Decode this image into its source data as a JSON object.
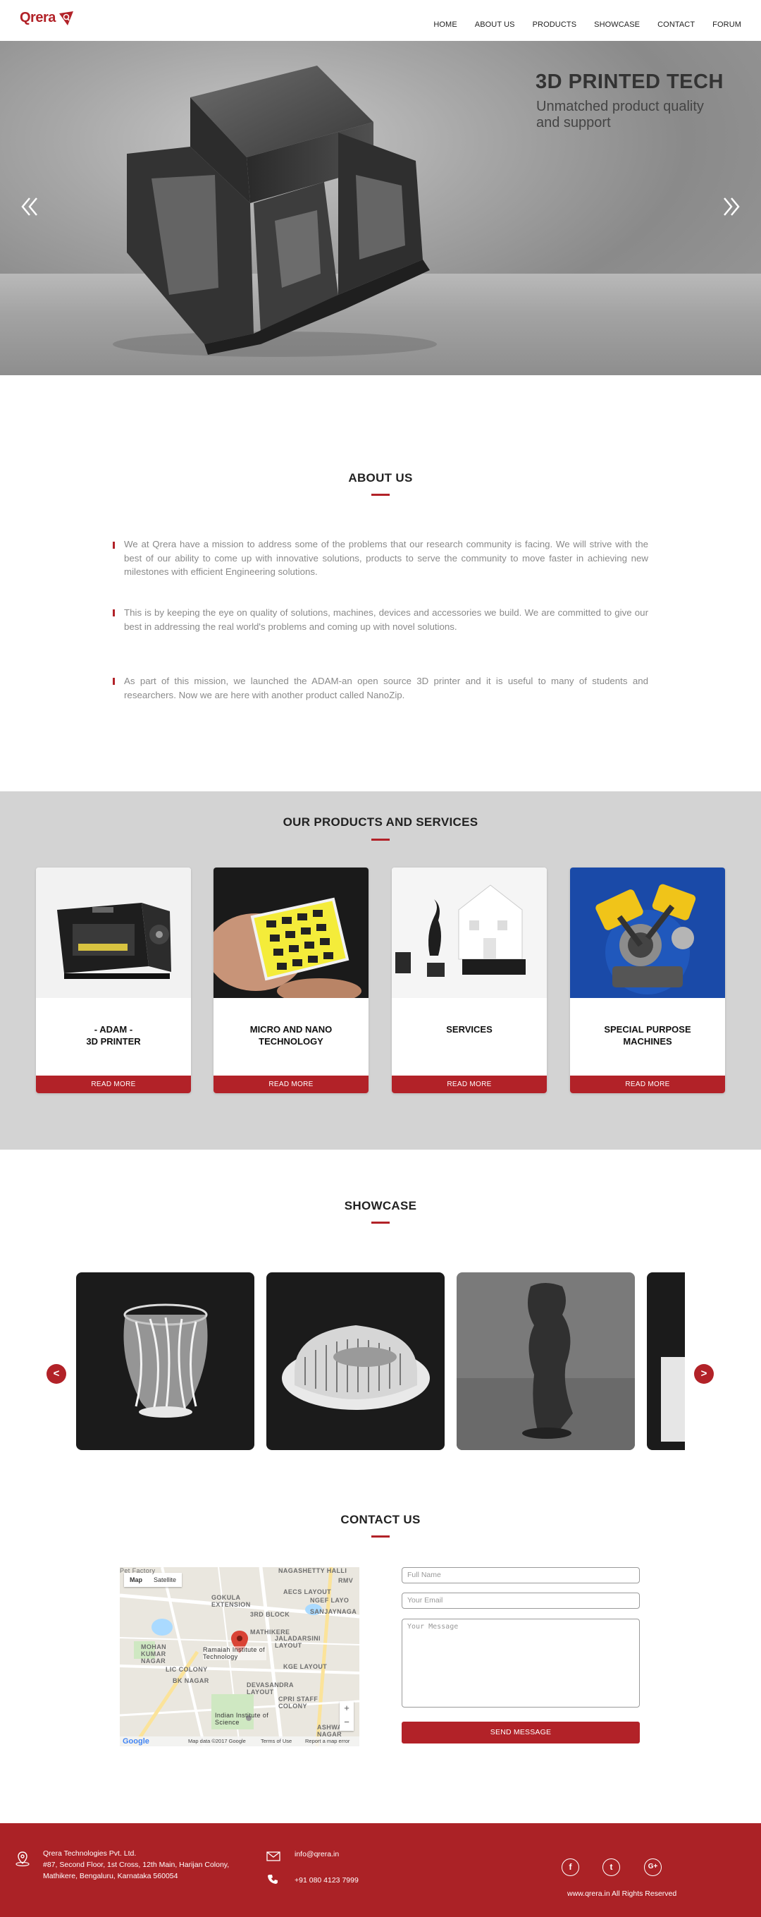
{
  "brand": {
    "name": "Qrera",
    "accent": "#b22228"
  },
  "nav": {
    "items": [
      "HOME",
      "ABOUT US",
      "PRODUCTS",
      "SHOWCASE",
      "CONTACT",
      "FORUM"
    ]
  },
  "hero": {
    "title": "3D PRINTED TECH",
    "subtitle": "Unmatched product quality and support",
    "prev_icon": "double-chevron-left-icon",
    "next_icon": "double-chevron-right-icon"
  },
  "about": {
    "title": "ABOUT US",
    "paragraphs": [
      "We at Qrera have a mission to address some of the problems that our research community is facing. We will strive with the best of our ability to come up with innovative solutions, products to serve the community to move faster in achieving new milestones with efficient Engineering solutions.",
      "This is by keeping the eye on quality of solutions, machines, devices and accessories we build. We are committed to give our best in addressing the real world's problems and coming up with novel solutions.",
      "As part of this mission, we launched the ADAM-an open source 3D printer and it is useful to many of students and researchers. Now we are here with another product called NanoZip."
    ]
  },
  "products": {
    "title": "OUR PRODUCTS AND SERVICES",
    "cards": [
      {
        "line1": "- ADAM -",
        "line2": "3D PRINTER",
        "button": "READ MORE"
      },
      {
        "line1": "MICRO AND NANO",
        "line2": "TECHNOLOGY",
        "button": "READ MORE"
      },
      {
        "line1": "SERVICES",
        "line2": "",
        "button": "READ MORE"
      },
      {
        "line1": "SPECIAL PURPOSE",
        "line2": "MACHINES",
        "button": "READ MORE"
      }
    ]
  },
  "showcase": {
    "title": "SHOWCASE",
    "prev": "<",
    "next": ">"
  },
  "contact": {
    "title": "CONTACT US",
    "map": {
      "tab_map": "Map",
      "tab_satellite": "Satellite",
      "place": "Ramaiah Institute of Technology",
      "place2": "Indian Institute of Science",
      "labels": [
        "GOKULA EXTENSION",
        "3RD BLOCK",
        "MATHIKERE",
        "MOHAN KUMAR NAGAR",
        "DEVASANDRA LAYOUT",
        "AECS LAYOUT",
        "NGEF LAYO",
        "SANJAYNAGA",
        "JALADARSINI LAYOUT",
        "LIC COLONY",
        "BK NAGAR",
        "KGE LAYOUT",
        "CPRI STAFF COLONY",
        "ASHWA NAGAR",
        "Pet Factory",
        "NAGASHETTY HALLI",
        "RMV"
      ],
      "footer_data": "Map data ©2017 Google",
      "footer_terms": "Terms of Use",
      "footer_report": "Report a map error",
      "google": "Google"
    },
    "form": {
      "name_placeholder": "Full Name",
      "email_placeholder": "Your Email",
      "message_placeholder": "Your Message",
      "send": "SEND MESSAGE"
    }
  },
  "footer": {
    "company": "Qrera Technologies Pvt. Ltd.",
    "address1": "#87, Second Floor, 1st Cross, 12th Main, Harijan Colony,",
    "address2": "Mathikere, Bengaluru, Karnataka 560054",
    "email": "info@qrera.in",
    "phone": "+91 080 4123 7999",
    "social": [
      "f",
      "t",
      "G+"
    ],
    "copyright": "www.qrera.in All Rights Reserved"
  }
}
